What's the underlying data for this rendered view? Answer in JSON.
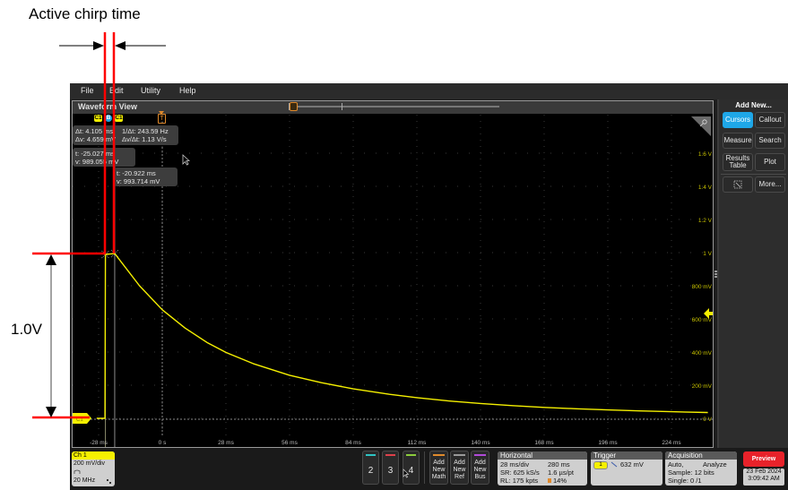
{
  "annotation": {
    "title": "Active chirp time",
    "voltage_label": "1.0V",
    "marker_color": "#ff0000"
  },
  "menu": [
    "File",
    "Edit",
    "Utility",
    "Help"
  ],
  "waveform_view": {
    "title": "Waveform View",
    "cursor_tags": [
      "C1",
      "B",
      "C1"
    ],
    "trigger_tag": "T",
    "readouts": {
      "delta": {
        "dt": "Δt: 4.105 ms",
        "dv": "Δv: 4.659 mV",
        "inv_dt": "1/Δt: 243.59 Hz",
        "dv_dt": "Δv/Δt: 1.13 V/s"
      },
      "cursor_a": {
        "t": "t: -25.027 ms",
        "v": "v: 989.055 mV"
      },
      "cursor_b": {
        "t": "t: -20.922 ms",
        "v": "v: 993.714 mV"
      }
    },
    "ch_marker": "C1"
  },
  "colors": {
    "trace": "#f5f000",
    "accent_blue": "#1ea7e8",
    "preview_red": "#e8222a",
    "ch2": "#2ec4c4",
    "ch3": "#e0404a",
    "ch4": "#8ccc3c",
    "math": "#e08a2c",
    "ref": "#9a9a9a",
    "bus": "#b04ad8"
  },
  "chart_data": {
    "type": "line",
    "title": "Waveform View",
    "xlabel": "",
    "ylabel": "",
    "x_unit": "ms",
    "y_unit": "V",
    "xlim": [
      -30,
      240
    ],
    "ylim": [
      -0.08,
      1.8
    ],
    "x_ticks": [
      -28,
      0,
      28,
      56,
      84,
      112,
      140,
      168,
      196,
      224
    ],
    "x_tick_labels": [
      "-28 ms",
      "0 s",
      "28 ms",
      "56 ms",
      "84 ms",
      "112 ms",
      "140 ms",
      "168 ms",
      "196 ms",
      "224 ms"
    ],
    "y_ticks": [
      1.6,
      1.4,
      1.2,
      1.0,
      0.8,
      0.6,
      0.4,
      0.2,
      0.0
    ],
    "y_tick_labels": [
      "1.6 V",
      "1.4 V",
      "1.2 V",
      "1 V",
      "800 mV",
      "600 mV",
      "400 mV",
      "200 mV",
      "0 V"
    ],
    "grid": true,
    "series": [
      {
        "name": "Ch 1",
        "x": [
          -30,
          -25.2,
          -25.0,
          -21.0,
          -20.9,
          -10,
          0,
          10,
          20,
          28,
          40,
          56,
          70,
          84,
          100,
          112,
          126,
          140,
          154,
          168,
          182,
          196,
          210,
          224,
          240
        ],
        "y": [
          0.0,
          0.0,
          0.989,
          0.994,
          0.994,
          0.8,
          0.655,
          0.545,
          0.455,
          0.398,
          0.33,
          0.26,
          0.215,
          0.178,
          0.145,
          0.125,
          0.105,
          0.09,
          0.077,
          0.066,
          0.058,
          0.051,
          0.045,
          0.04,
          0.035
        ]
      }
    ],
    "cursors": {
      "a_ms": -25.027,
      "b_ms": -20.922
    },
    "trigger_level": "632 mV"
  },
  "right_panel": {
    "title": "Add New...",
    "buttons": [
      "Cursors",
      "Callout",
      "Measure",
      "Search",
      "Results Table",
      "Plot",
      "",
      "More..."
    ]
  },
  "bottom": {
    "ch1": {
      "label": "Ch 1",
      "scale": "200 mV/div",
      "bandwidth": "20 MHz"
    },
    "channel_buttons": [
      "2",
      "3",
      "4"
    ],
    "add_buttons": [
      "Add New Math",
      "Add New Ref",
      "Add New Bus"
    ],
    "horizontal": {
      "title": "Horizontal",
      "scale": "28 ms/div",
      "duration": "280 ms",
      "sample_rate": "SR: 625 kS/s",
      "resolution": "1.6 µs/pt",
      "record_length": "RL: 175 kpts",
      "position": "14%"
    },
    "trigger": {
      "title": "Trigger",
      "source": "1",
      "level": "632 mV"
    },
    "acquisition": {
      "title": "Acquisition",
      "mode": "Auto,",
      "analyze": "Analyze",
      "sample": "Sample: 12 bits",
      "single": "Single: 0 /1"
    },
    "preview_label": "Preview",
    "date": "23 Feb 2024",
    "time": "3:09:42 AM"
  }
}
